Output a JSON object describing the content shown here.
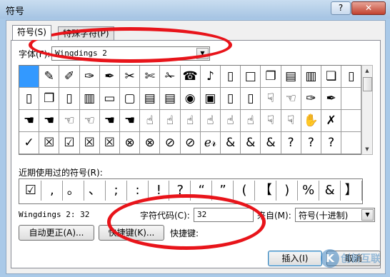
{
  "window": {
    "title": "符号",
    "help_glyph": "?",
    "close_glyph": "✕"
  },
  "tabs": [
    {
      "label": "符号(S)"
    },
    {
      "label": "特殊字符(P)"
    }
  ],
  "font": {
    "label": "字体(F):",
    "value": "Wingdings 2"
  },
  "symbol_grid": [
    [
      "",
      "✎",
      "✐",
      "✑",
      "✒",
      "✂",
      "✄",
      "✁",
      "☎",
      "♪",
      "▯",
      "□",
      "❐",
      "▤",
      "▥",
      "❏",
      "▯"
    ],
    [
      "▯",
      "❐",
      "▯",
      "▥",
      "▭",
      "▢",
      "▤",
      "▤",
      "◉",
      "▣",
      "▯",
      "▯",
      "☟",
      "☜",
      "✑",
      "✒",
      ""
    ],
    [
      "☚",
      "☚",
      "☜",
      "☜",
      "☚",
      "☚",
      "☝",
      "☝",
      "☝",
      "☝",
      "☝",
      "☝",
      "☟",
      "☟",
      "✋",
      "✗",
      ""
    ],
    [
      "✓",
      "☒",
      "☑",
      "☒",
      "☒",
      "⊗",
      "⊗",
      "⊘",
      "⊘",
      "ℯ𝓇",
      "&",
      "&",
      "&",
      "?",
      "?",
      "?",
      ""
    ]
  ],
  "recent": {
    "label": "近期使用过的符号(R):",
    "items": [
      "☑",
      ",",
      "。",
      "、",
      ";",
      ":",
      "!",
      "?",
      "“",
      "”",
      "(",
      "【",
      ")",
      "%",
      "&",
      "】"
    ]
  },
  "char_info": {
    "name": "Wingdings 2: 32",
    "code_label": "字符代码(C):",
    "code_value": "32",
    "from_label": "来自(M):",
    "from_value": "符号(十进制)"
  },
  "buttons": {
    "autocorrect": "自动更正(A)...",
    "shortcut_key": "快捷键(K)...",
    "shortcut_label": "快捷键:",
    "insert": "插入(I)",
    "cancel": "取消"
  },
  "watermark": {
    "logo": "K",
    "text": "创新互联"
  },
  "colors": {
    "accent": "#3399ff",
    "annotation": "#e8141a",
    "title_bar": "#a6c4e3"
  }
}
